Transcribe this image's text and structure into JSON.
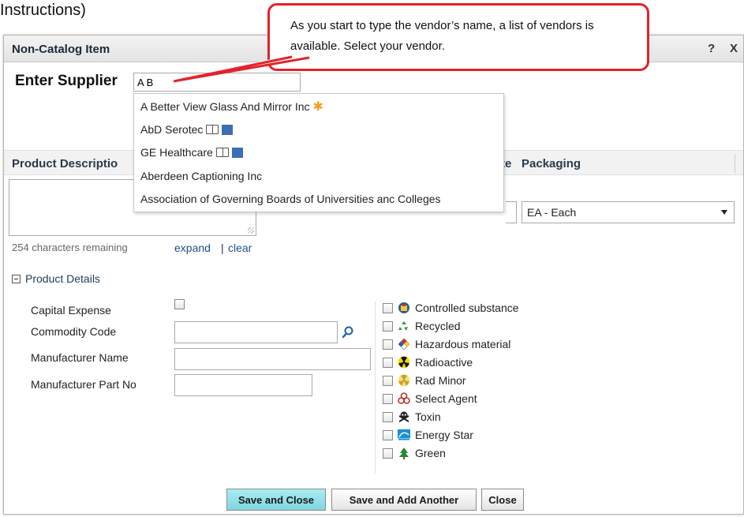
{
  "caption": "Instructions)",
  "dialog": {
    "title": "Non-Catalog Item",
    "help": "?",
    "close": "X"
  },
  "supplier": {
    "label": "Enter Supplier",
    "value": "A B",
    "suggestions": [
      {
        "name": "A Better View Glass And Mirror Inc",
        "icons": [
          "star-icon"
        ]
      },
      {
        "name": "AbD Serotec",
        "icons": [
          "book-icon",
          "catalog-icon"
        ]
      },
      {
        "name": "GE Healthcare",
        "icons": [
          "book-icon",
          "catalog-icon"
        ]
      },
      {
        "name": "Aberdeen Captioning Inc",
        "icons": []
      },
      {
        "name": "Association of Governing Boards of Universities anc Colleges",
        "icons": []
      }
    ]
  },
  "columns": {
    "product_description": "Product Descriptio",
    "rate_partial": "te",
    "packaging": "Packaging"
  },
  "packaging_value": "EA - Each",
  "description": {
    "chars_remaining": "254 characters remaining",
    "expand": "expand",
    "separator": "|",
    "clear": "clear"
  },
  "product_details": {
    "toggle_label": "Product Details",
    "fields": {
      "capital_expense": "Capital Expense",
      "commodity_code": "Commodity Code",
      "manufacturer_name": "Manufacturer Name",
      "manufacturer_part_no": "Manufacturer Part No"
    },
    "hazards": [
      {
        "label": "Controlled substance",
        "icon": "controlled-substance-icon"
      },
      {
        "label": "Recycled",
        "icon": "recycle-icon"
      },
      {
        "label": "Hazardous material",
        "icon": "hazard-diamond-icon"
      },
      {
        "label": "Radioactive",
        "icon": "radioactive-icon"
      },
      {
        "label": "Rad Minor",
        "icon": "rad-minor-icon"
      },
      {
        "label": "Select Agent",
        "icon": "biohazard-icon"
      },
      {
        "label": "Toxin",
        "icon": "skull-icon"
      },
      {
        "label": "Energy Star",
        "icon": "energy-star-icon"
      },
      {
        "label": "Green",
        "icon": "tree-icon"
      }
    ]
  },
  "buttons": {
    "save_close": "Save and Close",
    "save_add": "Save and Add Another",
    "close": "Close"
  },
  "callout": {
    "text": "As you start to type the vendor’s name, a list of vendors is available. Select your vendor."
  },
  "colors": {
    "callout_border": "#e3222b",
    "primary_button": "#7fd6e0",
    "link": "#1e4f8a"
  }
}
